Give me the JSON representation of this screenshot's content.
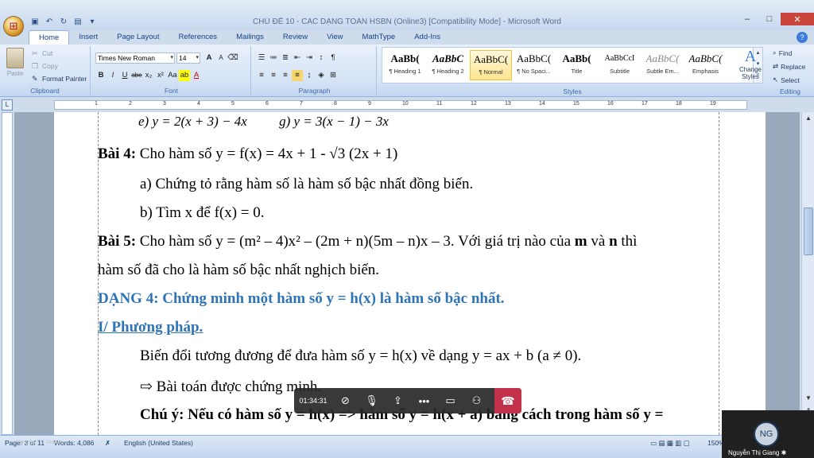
{
  "window": {
    "title": "CHỦ ĐỀ 10 - CÁC DẠNG TOÁN HSBN (Online3) [Compatibility Mode] - Microsoft Word",
    "qat_icons": [
      "save-icon",
      "undo-icon",
      "redo-icon",
      "print-preview-icon",
      "customize-icon"
    ],
    "controls": {
      "minimize": "–",
      "maximize": "□",
      "close": "✕"
    }
  },
  "tabs": [
    "Home",
    "Insert",
    "Page Layout",
    "References",
    "Mailings",
    "Review",
    "View",
    "MathType",
    "Add-Ins"
  ],
  "ribbon": {
    "clipboard": {
      "label": "Clipboard",
      "paste": "Paste",
      "cut": "Cut",
      "copy": "Copy",
      "format_painter": "Format Painter"
    },
    "font": {
      "label": "Font",
      "family": "Times New Roman",
      "size": "14",
      "bold": "B",
      "italic": "I",
      "underline": "U",
      "strikethrough": "abe",
      "subscript": "x₂",
      "superscript": "x²",
      "change_case": "Aa",
      "highlight": "ab",
      "font_color": "A",
      "grow": "A",
      "shrink": "A"
    },
    "paragraph": {
      "label": "Paragraph"
    },
    "styles": {
      "label": "Styles",
      "items": [
        {
          "preview": "AaBb(",
          "name": "¶ Heading 1"
        },
        {
          "preview": "AaBbC",
          "name": "¶ Heading 2"
        },
        {
          "preview": "AaBbC(",
          "name": "¶ Normal"
        },
        {
          "preview": "AaBbC(",
          "name": "¶ No Spaci..."
        },
        {
          "preview": "AaBb(",
          "name": "Title"
        },
        {
          "preview": "AaBbCcI",
          "name": "Subtitle"
        },
        {
          "preview": "AaBbC(",
          "name": "Subtle Em..."
        },
        {
          "preview": "AaBbC(",
          "name": "Emphasis"
        }
      ],
      "change_styles": "Change Styles"
    },
    "editing": {
      "label": "Editing",
      "find": "Find",
      "replace": "Replace",
      "select": "Select"
    }
  },
  "ruler": {
    "numbers": [
      "1",
      "2",
      "3",
      "4",
      "5",
      "6",
      "7",
      "8",
      "9",
      "10",
      "11",
      "12",
      "13",
      "14",
      "15",
      "16",
      "17",
      "18",
      "19"
    ]
  },
  "document": {
    "line_e": "e) y = 2(x + 3) − 4x",
    "line_g": "g)  y = 3(x − 1) − 3x",
    "bai4_label": "Bài 4:",
    "bai4_text": " Cho hàm số y = f(x) = 4x + 1 - √3 (2x + 1)",
    "bai4_a": "a) Chứng tỏ rằng hàm số là hàm số bậc nhất đồng biến.",
    "bai4_b": "b) Tìm x để f(x) = 0.",
    "bai5_label": "Bài 5:",
    "bai5_text": " Cho hàm số y = (m² – 4)x² – (2m + n)(5m – n)x – 3. Với giá trị nào của ",
    "bai5_m": "m",
    "bai5_and": " và ",
    "bai5_n": "n",
    "bai5_end": " thì",
    "bai5_line2": "hàm số đã cho là hàm số bậc nhất nghịch biến.",
    "dang4": "DẠNG 4: Chứng minh một hàm số y = h(x)  là hàm số bậc nhất.",
    "phuong_phap": "I/ Phương pháp.",
    "bien_doi": "Biến đổi tương đương để đưa hàm số y = h(x)  về dạng y = ax + b (a ≠ 0).",
    "arrow_line": "⇨ Bài toán được chứng minh.",
    "chu_y": "Chú ý: Nếu có hàm số y = h(x) => hàm số y = h(x + a) bằng cách trong hàm số y ="
  },
  "status": {
    "page": "Page: 3 of 11",
    "words": "Words: 4,086",
    "language": "English (United States)",
    "zoom": "150%",
    "presenter": "Nguyễn Thị Giang"
  },
  "meeting": {
    "timer": "01:34:31",
    "icons": [
      "camera-off-icon",
      "mic-off-icon",
      "share-screen-icon",
      "more-icon",
      "chat-icon",
      "participants-icon",
      "hang-up-icon"
    ],
    "participant_initials": "NG",
    "participant_name": "Nguyễn Thị Giang"
  }
}
